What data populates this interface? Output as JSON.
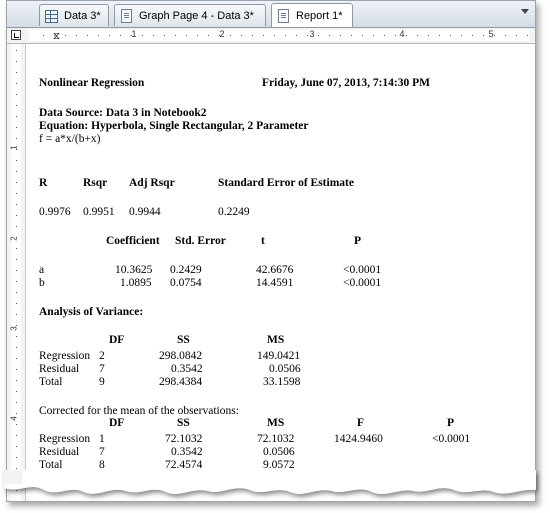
{
  "tabs": [
    {
      "label": "Data 3*",
      "icon": "table-icon"
    },
    {
      "label": "Graph Page 4 - Data 3*",
      "icon": "graph-page-icon"
    },
    {
      "label": "Report 1*",
      "icon": "report-page-icon"
    }
  ],
  "ruler": {
    "numbers": [
      "1",
      "2",
      "3",
      "4",
      "5"
    ],
    "vnumbers": [
      "1",
      "2",
      "3",
      "4"
    ]
  },
  "report": {
    "title": "Nonlinear Regression",
    "datetime": "Friday, June 07, 2013, 7:14:30 PM",
    "data_source": "Data Source: Data 3 in Notebook2",
    "equation": "Equation: Hyperbola, Single Rectangular, 2 Parameter",
    "formula": "f = a*x/(b+x)",
    "stats_headers": [
      "R",
      "Rsqr",
      "Adj Rsqr",
      "Standard Error of Estimate"
    ],
    "stats_values": [
      "0.9976",
      "0.9951",
      "0.9944",
      "0.2249"
    ],
    "coef_headers": [
      "Coefficient",
      "Std. Error",
      "t",
      "P"
    ],
    "coef_rows": [
      {
        "name": "a",
        "coef": "10.3625",
        "se": "0.2429",
        "t": "42.6676",
        "p": "<0.0001"
      },
      {
        "name": "b",
        "coef": "1.0895",
        "se": "0.0754",
        "t": "14.4591",
        "p": "<0.0001"
      }
    ],
    "anova_title": "Analysis of Variance:",
    "anova_headers": [
      "DF",
      "SS",
      "MS"
    ],
    "anova_rows": [
      {
        "name": "Regression",
        "df": "2",
        "ss": "298.0842",
        "ms": "149.0421"
      },
      {
        "name": "Residual",
        "df": "7",
        "ss": "0.3542",
        "ms": "0.0506"
      },
      {
        "name": "Total",
        "df": "9",
        "ss": "298.4384",
        "ms": "33.1598"
      }
    ],
    "corrected_title": "Corrected for the mean of the observations:",
    "corrected_headers": [
      "DF",
      "SS",
      "MS",
      "F",
      "P"
    ],
    "corrected_rows": [
      {
        "name": "Regression",
        "df": "1",
        "ss": "72.1032",
        "ms": "72.1032",
        "f": "1424.9460",
        "p": "<0.0001"
      },
      {
        "name": "Residual",
        "df": "7",
        "ss": "0.3542",
        "ms": "0.0506",
        "f": "",
        "p": ""
      },
      {
        "name": "Total",
        "df": "8",
        "ss": "72.4574",
        "ms": "9.0572",
        "f": "",
        "p": ""
      }
    ]
  }
}
